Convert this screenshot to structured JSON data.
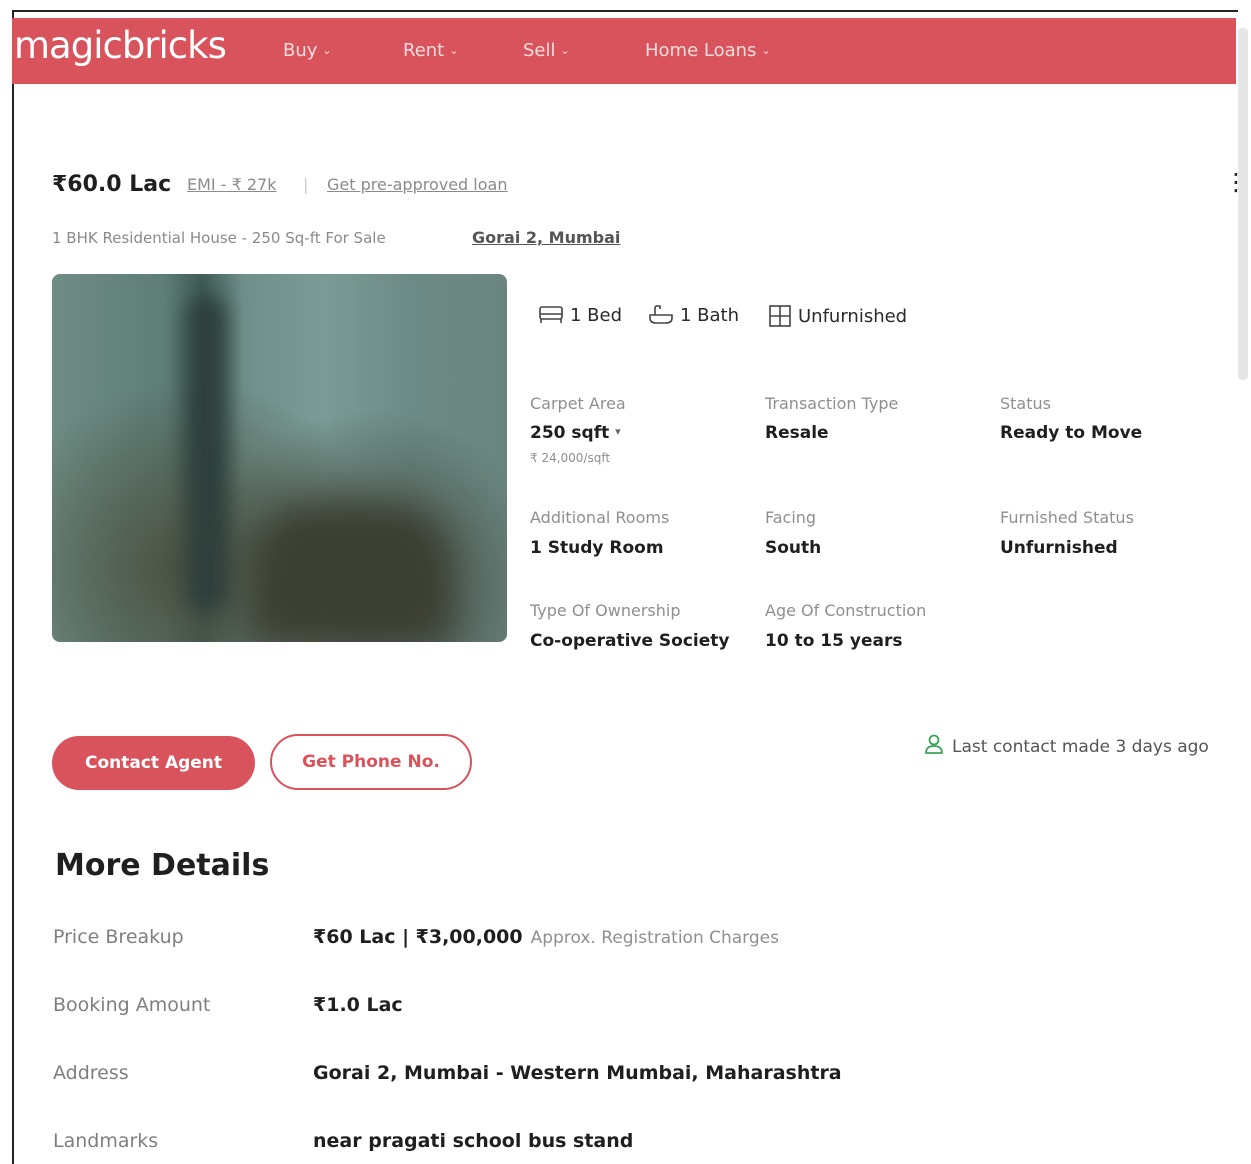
{
  "brand": {
    "logo": "magicbricks",
    "accent": "#d9535c"
  },
  "nav": [
    {
      "label": "Buy",
      "chevron": "⌄"
    },
    {
      "label": "Rent",
      "chevron": "⌄"
    },
    {
      "label": "Sell",
      "chevron": "⌄"
    },
    {
      "label": "Home Loans",
      "chevron": "⌄"
    }
  ],
  "listing": {
    "price": "₹60.0 Lac",
    "emi_link": "EMI - ₹ 27k",
    "separator": "|",
    "preapproved_link": "Get pre-approved loan",
    "subtitle": "1 BHK Residential House - 250 Sq-ft For Sale",
    "location_link": "Gorai 2, Mumbai",
    "features": [
      {
        "icon": "bed-icon",
        "label": "1 Bed"
      },
      {
        "icon": "bath-icon",
        "label": "1 Bath"
      },
      {
        "icon": "furniture-icon",
        "label": "Unfurnished"
      }
    ],
    "details": [
      {
        "label": "Carpet Area",
        "value": "250 sqft",
        "sub": "₹ 24,000/sqft"
      },
      {
        "label": "Transaction Type",
        "value": "Resale"
      },
      {
        "label": "Status",
        "value": "Ready to Move"
      },
      {
        "label": "Additional Rooms",
        "value": "1 Study Room"
      },
      {
        "label": "Facing",
        "value": "South"
      },
      {
        "label": "Furnished Status",
        "value": "Unfurnished"
      },
      {
        "label": "Type Of Ownership",
        "value": "Co-operative Society"
      },
      {
        "label": "Age Of Construction",
        "value": "10 to 15 years"
      }
    ],
    "carpet_dropdown": "▾"
  },
  "actions": {
    "contact_agent": "Contact Agent",
    "get_phone": "Get Phone No.",
    "last_contact": "Last contact made 3 days ago"
  },
  "more_details": {
    "title": "More Details",
    "rows": [
      {
        "label": "Price Breakup",
        "value": "₹60 Lac | ₹3,00,000",
        "note": "Approx. Registration Charges"
      },
      {
        "label": "Booking Amount",
        "value": "₹1.0 Lac"
      },
      {
        "label": "Address",
        "value": "Gorai 2, Mumbai - Western Mumbai, Maharashtra"
      },
      {
        "label": "Landmarks",
        "value": "near pragati school bus stand"
      }
    ]
  },
  "menu": {
    "kebab": "⋮"
  }
}
